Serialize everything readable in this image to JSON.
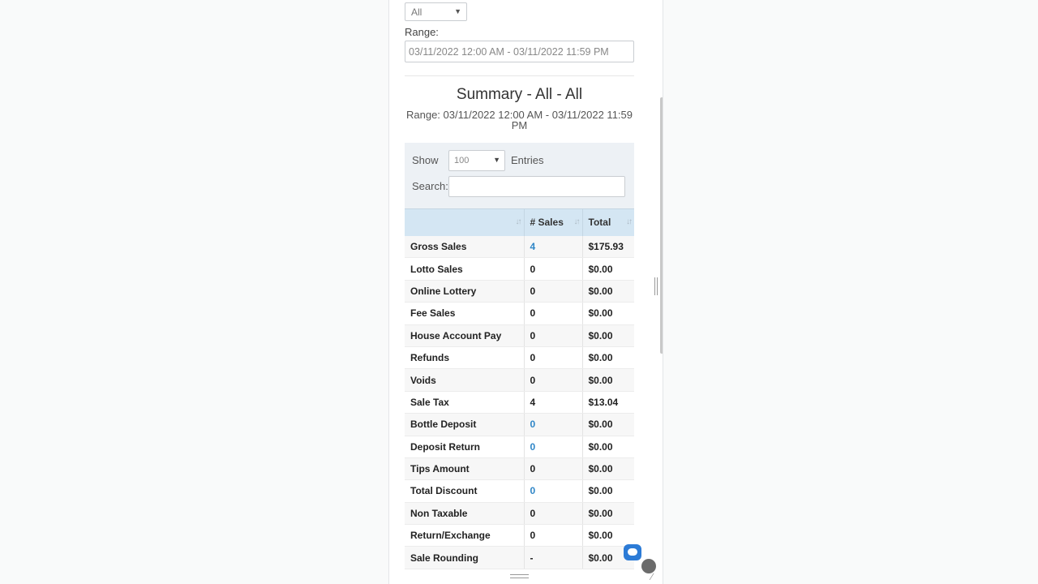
{
  "filters": {
    "select_value": "All",
    "range_label": "Range:",
    "range_value": "03/11/2022 12:00 AM - 03/11/2022 11:59 PM"
  },
  "summary": {
    "title": "Summary - All - All",
    "range_line1": "Range: 03/11/2022 12:00 AM - 03/11/2022 11:59",
    "range_line2": "PM"
  },
  "controls": {
    "show_label": "Show",
    "show_value": "100",
    "entries_label": "Entries",
    "search_label": "Search:"
  },
  "table": {
    "headers": [
      "",
      "# Sales",
      "Total"
    ],
    "rows": [
      {
        "label": "Gross Sales",
        "sales": "4",
        "total": "$175.93",
        "link": true
      },
      {
        "label": "Lotto Sales",
        "sales": "0",
        "total": "$0.00",
        "link": false
      },
      {
        "label": "Online Lottery",
        "sales": "0",
        "total": "$0.00",
        "link": false
      },
      {
        "label": "Fee Sales",
        "sales": "0",
        "total": "$0.00",
        "link": false
      },
      {
        "label": "House Account Pay",
        "sales": "0",
        "total": "$0.00",
        "link": false
      },
      {
        "label": "Refunds",
        "sales": "0",
        "total": "$0.00",
        "link": false
      },
      {
        "label": "Voids",
        "sales": "0",
        "total": "$0.00",
        "link": false
      },
      {
        "label": "Sale Tax",
        "sales": "4",
        "total": "$13.04",
        "link": false
      },
      {
        "label": "Bottle Deposit",
        "sales": "0",
        "total": "$0.00",
        "link": true
      },
      {
        "label": "Deposit Return",
        "sales": "0",
        "total": "$0.00",
        "link": true
      },
      {
        "label": "Tips Amount",
        "sales": "0",
        "total": "$0.00",
        "link": false
      },
      {
        "label": "Total Discount",
        "sales": "0",
        "total": "$0.00",
        "link": true
      },
      {
        "label": "Non Taxable",
        "sales": "0",
        "total": "$0.00",
        "link": false
      },
      {
        "label": "Return/Exchange",
        "sales": "0",
        "total": "$0.00",
        "link": false
      },
      {
        "label": "Sale Rounding",
        "sales": "-",
        "total": "$0.00",
        "link": false
      }
    ]
  },
  "icons": {
    "sort": "sort-icon",
    "chat": "chat-icon",
    "chevron": "chevron-down-icon"
  },
  "colors": {
    "link": "#2f86c7",
    "header_bg": "#d4e6f3",
    "controls_bg": "#edf1f5",
    "chat": "#2c7bd6"
  }
}
